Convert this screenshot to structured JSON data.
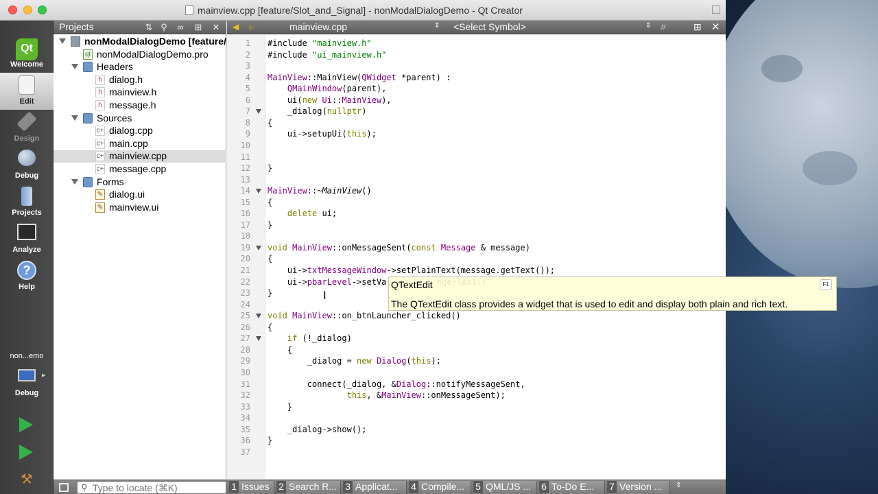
{
  "window": {
    "title": "mainview.cpp [feature/Slot_and_Signal] - nonModalDialogDemo - Qt Creator"
  },
  "modes": [
    {
      "label": "Welcome",
      "icon": "qt-logo-icon"
    },
    {
      "label": "Edit",
      "icon": "document-icon"
    },
    {
      "label": "Design",
      "icon": "pencil-icon"
    },
    {
      "label": "Debug",
      "icon": "bug-icon"
    },
    {
      "label": "Projects",
      "icon": "wrench-icon"
    },
    {
      "label": "Analyze",
      "icon": "chart-icon"
    },
    {
      "label": "Help",
      "icon": "help-icon"
    }
  ],
  "qt_logo_text": "Qt",
  "help_glyph": "?",
  "target": {
    "project": "non...emo",
    "mode": "Debug"
  },
  "projects_pane": {
    "title": "Projects",
    "tree": [
      {
        "label": "nonModalDialogDemo [feature/Slot_and_Signal]",
        "level": 0,
        "icon": "project-icon",
        "arrow": true,
        "bold": true
      },
      {
        "label": "nonModalDialogDemo.pro",
        "level": 1,
        "icon": "pro-file-icon"
      },
      {
        "label": "Headers",
        "level": 1,
        "icon": "folder-icon",
        "arrow": true
      },
      {
        "label": "dialog.h",
        "level": 2,
        "icon": "header-file-icon"
      },
      {
        "label": "mainview.h",
        "level": 2,
        "icon": "header-file-icon"
      },
      {
        "label": "message.h",
        "level": 2,
        "icon": "header-file-icon"
      },
      {
        "label": "Sources",
        "level": 1,
        "icon": "folder-icon",
        "arrow": true
      },
      {
        "label": "dialog.cpp",
        "level": 2,
        "icon": "cpp-file-icon"
      },
      {
        "label": "main.cpp",
        "level": 2,
        "icon": "cpp-file-icon"
      },
      {
        "label": "mainview.cpp",
        "level": 2,
        "icon": "cpp-file-icon",
        "selected": true
      },
      {
        "label": "message.cpp",
        "level": 2,
        "icon": "cpp-file-icon"
      },
      {
        "label": "Forms",
        "level": 1,
        "icon": "forms-folder-icon",
        "arrow": true
      },
      {
        "label": "dialog.ui",
        "level": 2,
        "icon": "ui-file-icon"
      },
      {
        "label": "mainview.ui",
        "level": 2,
        "icon": "ui-file-icon"
      }
    ]
  },
  "editor": {
    "file_combo": "mainview.cpp",
    "symbol_combo": "<Select Symbol>",
    "hash_glyph": "#",
    "lines": [
      {
        "n": "1",
        "html": "#include <span class=\"st\">\"mainview.h\"</span>"
      },
      {
        "n": "2",
        "html": "#include <span class=\"st\">\"ui_mainview.h\"</span>"
      },
      {
        "n": "3",
        "html": ""
      },
      {
        "n": "4",
        "html": "<span class=\"ty\">MainView</span>::MainView(<span class=\"ty\">QWidget</span> *parent) :"
      },
      {
        "n": "5",
        "html": "    <span class=\"ty\">QMainWindow</span>(parent),"
      },
      {
        "n": "6",
        "html": "    ui(<span class=\"kw\">new</span> <span class=\"ty\">Ui</span>::<span class=\"ty\">MainView</span>),"
      },
      {
        "n": "7",
        "html": "    _dialog(<span class=\"kw\">nullptr</span>)",
        "fold": true
      },
      {
        "n": "8",
        "html": "{"
      },
      {
        "n": "9",
        "html": "    ui-&gt;setupUi(<span class=\"kw\">this</span>);"
      },
      {
        "n": "10",
        "html": ""
      },
      {
        "n": "11",
        "html": ""
      },
      {
        "n": "12",
        "html": "}"
      },
      {
        "n": "13",
        "html": ""
      },
      {
        "n": "14",
        "html": "<span class=\"ty\">MainView</span>::~<span class=\"it\">MainView</span>()",
        "fold": true
      },
      {
        "n": "15",
        "html": "{"
      },
      {
        "n": "16",
        "html": "    <span class=\"kw\">delete</span> ui;"
      },
      {
        "n": "17",
        "html": "}"
      },
      {
        "n": "18",
        "html": ""
      },
      {
        "n": "19",
        "html": "<span class=\"kw\">void</span> <span class=\"ty\">MainView</span>::onMessageSent(<span class=\"kw\">const</span> <span class=\"ty\">Message</span> &amp; message)",
        "fold": true
      },
      {
        "n": "20",
        "html": "{"
      },
      {
        "n": "21",
        "html": "    ui-&gt;<span class=\"ty\">txtMessageWindow</span>-&gt;setPlainText(message.getText());"
      },
      {
        "n": "22",
        "html": "    ui-&gt;<span class=\"ty\">pbarLevel</span>-&gt;setVa"
      },
      {
        "n": "23",
        "html": "}"
      },
      {
        "n": "24",
        "html": ""
      },
      {
        "n": "25",
        "html": "<span class=\"kw\">void</span> <span class=\"ty\">MainView</span>::on_btnLauncher_clicked()",
        "fold": true
      },
      {
        "n": "26",
        "html": "{"
      },
      {
        "n": "27",
        "html": "    <span class=\"kw\">if</span> (!_dialog)",
        "fold": true
      },
      {
        "n": "28",
        "html": "    {"
      },
      {
        "n": "29",
        "html": "        _dialog = <span class=\"kw\">new</span> <span class=\"ty\">Dialog</span>(<span class=\"kw\">this</span>);"
      },
      {
        "n": "30",
        "html": ""
      },
      {
        "n": "31",
        "html": "        connect(_dialog, &amp;<span class=\"ty\">Dialog</span>::notifyMessageSent,"
      },
      {
        "n": "32",
        "html": "                <span class=\"kw\">this</span>, &amp;<span class=\"ty\">MainView</span>::onMessageSent);"
      },
      {
        "n": "33",
        "html": "    }"
      },
      {
        "n": "34",
        "html": ""
      },
      {
        "n": "35",
        "html": "    _dialog-&gt;show();"
      },
      {
        "n": "36",
        "html": "}"
      },
      {
        "n": "37",
        "html": ""
      }
    ]
  },
  "tooltip": {
    "title": "QTextEdit",
    "body": "The QTextEdit class provides a widget that is used to edit and display both plain and rich text.",
    "key": "F1",
    "faded_code": "ngeFlex1()"
  },
  "statusbar": {
    "locator_placeholder": "Type to locate (⌘K)",
    "output_tabs": [
      {
        "num": "1",
        "label": "Issues"
      },
      {
        "num": "2",
        "label": "Search R..."
      },
      {
        "num": "3",
        "label": "Applicat..."
      },
      {
        "num": "4",
        "label": "Compile..."
      },
      {
        "num": "5",
        "label": "QML/JS ..."
      },
      {
        "num": "6",
        "label": "To-Do E..."
      },
      {
        "num": "7",
        "label": "Version ..."
      }
    ]
  },
  "colors": {
    "keyword": "#808000",
    "string": "#008000",
    "type": "#800080",
    "selection": "#dcdcdc",
    "tooltip_bg": "#ffffdc"
  }
}
